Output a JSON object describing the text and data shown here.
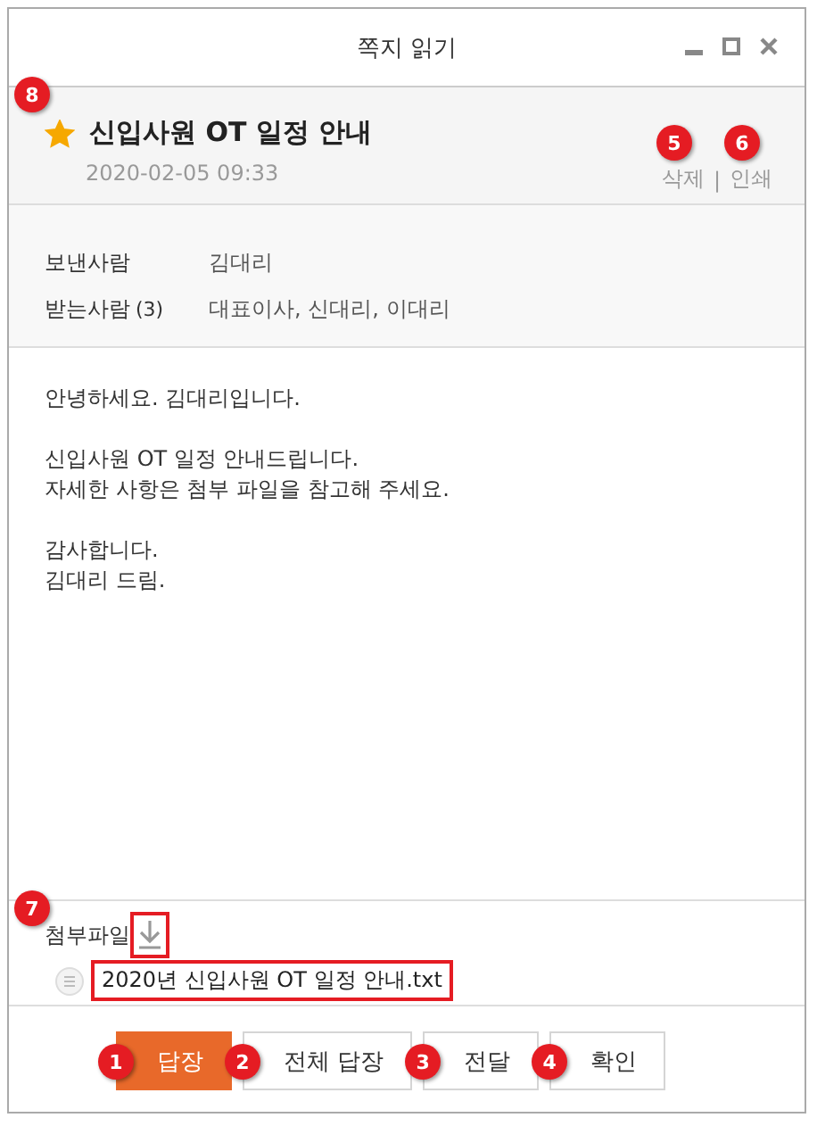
{
  "window": {
    "title": "쪽지 읽기"
  },
  "message": {
    "starred": true,
    "subject": "신입사원 OT 일정 안내",
    "date": "2020-02-05 09:33",
    "callout": "8",
    "separator": "|",
    "actions": [
      {
        "label": "삭제",
        "callout": "5"
      },
      {
        "label": "인쇄",
        "callout": "6"
      }
    ]
  },
  "sender": {
    "label": "보낸사람",
    "value": "김대리"
  },
  "recipients": {
    "label": "받는사람",
    "count": "(3)",
    "value": "대표이사, 신대리, 이대리"
  },
  "body": [
    [
      "안녕하세요. 김대리입니다."
    ],
    [
      "신입사원 OT 일정 안내드립니다.",
      "자세한 사항은 첨부 파일을 참고해 주세요."
    ],
    [
      "감사합니다.",
      "김대리 드림."
    ]
  ],
  "attachments": {
    "label": "첨부파일",
    "callout": "7",
    "download_highlighted": true,
    "files": [
      {
        "name": "2020년 신입사원 OT 일정 안내.txt",
        "highlighted": true
      }
    ]
  },
  "buttons": [
    {
      "label": "답장",
      "callout": "1",
      "primary": true
    },
    {
      "label": "전체 답장",
      "callout": "2",
      "primary": false
    },
    {
      "label": "전달",
      "callout": "3",
      "primary": false
    },
    {
      "label": "확인",
      "callout": "4",
      "primary": false
    }
  ]
}
